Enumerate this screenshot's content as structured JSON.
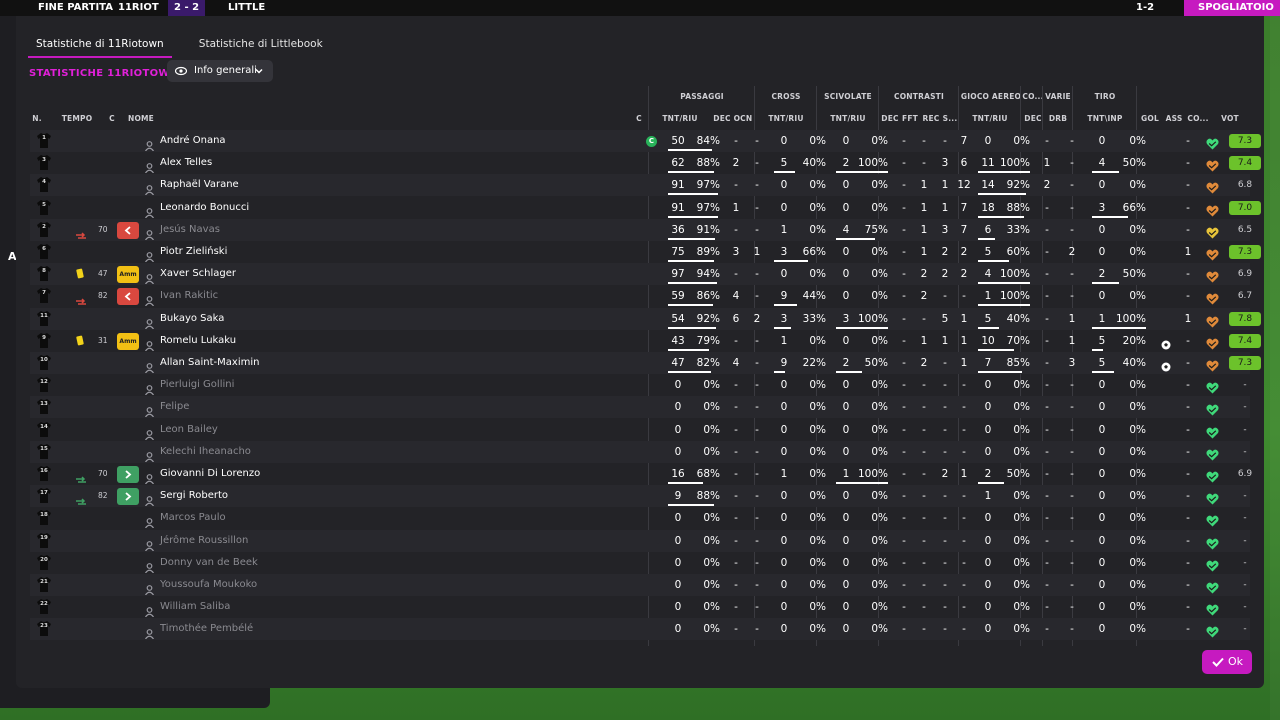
{
  "topbar": {
    "match_label": "FINE PARTITA",
    "home_team": "11RIOT",
    "score": "2 - 2",
    "away_team": "LITTLE",
    "extra": "1-2",
    "exit_label": "SPOGLIATOIO"
  },
  "left_letter": "A",
  "tabs": [
    {
      "label": "Statistiche di 11Riotown",
      "active": true
    },
    {
      "label": "Statistiche di Littlebook",
      "active": false
    }
  ],
  "section_title": "STATISTICHE 11RIOTOWN",
  "view_dropdown": {
    "label": "Info generali",
    "icon": "eye-icon"
  },
  "groups": {
    "passaggi": "PASSAGGI",
    "cross": "CROSS",
    "scivolate": "SCIVOLATE",
    "contrasti": "CONTRASTI",
    "gioco_aereo": "GIOCO AEREO",
    "co": "CO...",
    "varie": "VARIE",
    "tiro": "TIRO"
  },
  "columns": {
    "n": "N.",
    "tempo": "TEMPO",
    "c": "C",
    "nome": "NOME",
    "cap": "C",
    "pass_tnt": "TNT/RIU",
    "pass_dec": "DEC",
    "pass_ocn": "OCN",
    "cross_tnt": "TNT/RIU",
    "sciv_tnt": "TNT/RIU",
    "con_dec": "DEC",
    "con_fft": "FFT",
    "con_rec": "REC",
    "con_s": "S...",
    "aereo_tnt": "TNT/RIU",
    "co_dec": "DEC",
    "drb": "DRB",
    "tiro_tnt": "TNT\\INP",
    "gol": "GOL",
    "ass": "ASS",
    "cond": "CO...",
    "vot": "VOT"
  },
  "colors": {
    "accent": "#c61ac0",
    "vote_green": "#6cc22b",
    "heart_green": "#3fd97a",
    "heart_orange": "#e08a3a",
    "heart_yellow": "#e8c43a",
    "sub_out": "#d9483f",
    "sub_in": "#3fa063",
    "card_yellow": "#f2d21a"
  },
  "players": [
    {
      "num": "1",
      "name": "André Onana",
      "dim": false,
      "captain": "C",
      "tempo": "",
      "event": "",
      "minute": "",
      "pass": [
        "50",
        "84%"
      ],
      "pass_bar": 0.84,
      "pdec": "-",
      "pocn": "-",
      "cross": [
        "0",
        "0%"
      ],
      "cross_bar": 0,
      "sciv": [
        "0",
        "0%"
      ],
      "sciv_bar": 0,
      "cdec": "-",
      "cfft": "-",
      "crec": "-",
      "cs": "7",
      "aereo": [
        "0",
        "0%"
      ],
      "aereo_bar": 0,
      "codec": "-",
      "drb": "-",
      "tiro": [
        "0",
        "0%"
      ],
      "tiro_bar": 0,
      "gol": "",
      "ass": "-",
      "heart": "green",
      "vote": "7.3",
      "vote_green": true
    },
    {
      "num": "3",
      "name": "Alex Telles",
      "dim": false,
      "captain": "",
      "tempo": "",
      "event": "",
      "minute": "",
      "pass": [
        "62",
        "88%"
      ],
      "pass_bar": 0.88,
      "pdec": "2",
      "pocn": "-",
      "cross": [
        "5",
        "40%"
      ],
      "cross_bar": 0.4,
      "sciv": [
        "2",
        "100%"
      ],
      "sciv_bar": 1,
      "cdec": "-",
      "cfft": "-",
      "crec": "3",
      "cs": "6",
      "aereo": [
        "11",
        "100%"
      ],
      "aereo_bar": 1,
      "codec": "1",
      "drb": "-",
      "tiro": [
        "4",
        "50%"
      ],
      "tiro_bar": 0.5,
      "gol": "",
      "ass": "-",
      "heart": "orange",
      "vote": "7.4",
      "vote_green": true
    },
    {
      "num": "4",
      "name": "Raphaël Varane",
      "dim": false,
      "captain": "",
      "tempo": "",
      "event": "",
      "minute": "",
      "pass": [
        "91",
        "97%"
      ],
      "pass_bar": 0.97,
      "pdec": "-",
      "pocn": "-",
      "cross": [
        "0",
        "0%"
      ],
      "cross_bar": 0,
      "sciv": [
        "0",
        "0%"
      ],
      "sciv_bar": 0,
      "cdec": "-",
      "cfft": "1",
      "crec": "1",
      "cs": "12",
      "aereo": [
        "14",
        "92%"
      ],
      "aereo_bar": 0.92,
      "codec": "2",
      "drb": "-",
      "tiro": [
        "0",
        "0%"
      ],
      "tiro_bar": 0,
      "gol": "",
      "ass": "-",
      "heart": "orange",
      "vote": "6.8",
      "vote_green": false
    },
    {
      "num": "5",
      "name": "Leonardo Bonucci",
      "dim": false,
      "captain": "",
      "tempo": "",
      "event": "",
      "minute": "",
      "pass": [
        "91",
        "97%"
      ],
      "pass_bar": 0.97,
      "pdec": "1",
      "pocn": "-",
      "cross": [
        "0",
        "0%"
      ],
      "cross_bar": 0,
      "sciv": [
        "0",
        "0%"
      ],
      "sciv_bar": 0,
      "cdec": "-",
      "cfft": "1",
      "crec": "1",
      "cs": "7",
      "aereo": [
        "18",
        "88%"
      ],
      "aereo_bar": 0.88,
      "codec": "-",
      "drb": "-",
      "tiro": [
        "3",
        "66%"
      ],
      "tiro_bar": 0.66,
      "gol": "",
      "ass": "-",
      "heart": "orange",
      "vote": "7.0",
      "vote_green": true
    },
    {
      "num": "2",
      "name": "Jesús Navas",
      "dim": true,
      "captain": "",
      "tempo": "out",
      "event": "sub-out",
      "minute": "70",
      "pass": [
        "36",
        "91%"
      ],
      "pass_bar": 0.91,
      "pdec": "-",
      "pocn": "-",
      "cross": [
        "1",
        "0%"
      ],
      "cross_bar": 0,
      "sciv": [
        "4",
        "75%"
      ],
      "sciv_bar": 0.75,
      "cdec": "-",
      "cfft": "1",
      "crec": "3",
      "cs": "7",
      "aereo": [
        "6",
        "33%"
      ],
      "aereo_bar": 0.33,
      "codec": "-",
      "drb": "-",
      "tiro": [
        "0",
        "0%"
      ],
      "tiro_bar": 0,
      "gol": "",
      "ass": "-",
      "heart": "yellow",
      "vote": "6.5",
      "vote_green": false
    },
    {
      "num": "6",
      "name": "Piotr Zieliński",
      "dim": false,
      "captain": "",
      "tempo": "",
      "event": "",
      "minute": "",
      "pass": [
        "75",
        "89%"
      ],
      "pass_bar": 0.89,
      "pdec": "3",
      "pocn": "1",
      "cross": [
        "3",
        "66%"
      ],
      "cross_bar": 0.66,
      "sciv": [
        "0",
        "0%"
      ],
      "sciv_bar": 0,
      "cdec": "-",
      "cfft": "1",
      "crec": "2",
      "cs": "2",
      "aereo": [
        "5",
        "60%"
      ],
      "aereo_bar": 0.6,
      "codec": "-",
      "drb": "2",
      "tiro": [
        "0",
        "0%"
      ],
      "tiro_bar": 0,
      "gol": "",
      "ass": "1",
      "heart": "orange",
      "vote": "7.3",
      "vote_green": true
    },
    {
      "num": "8",
      "name": "Xaver Schlager",
      "dim": false,
      "captain": "",
      "tempo": "amm",
      "event": "yellow",
      "minute": "47",
      "pass": [
        "97",
        "94%"
      ],
      "pass_bar": 0.94,
      "pdec": "-",
      "pocn": "-",
      "cross": [
        "0",
        "0%"
      ],
      "cross_bar": 0,
      "sciv": [
        "0",
        "0%"
      ],
      "sciv_bar": 0,
      "cdec": "-",
      "cfft": "2",
      "crec": "2",
      "cs": "2",
      "aereo": [
        "4",
        "100%"
      ],
      "aereo_bar": 1,
      "codec": "-",
      "drb": "-",
      "tiro": [
        "2",
        "50%"
      ],
      "tiro_bar": 0.5,
      "gol": "",
      "ass": "-",
      "heart": "orange",
      "vote": "6.9",
      "vote_green": false
    },
    {
      "num": "7",
      "name": "Ivan Rakitic",
      "dim": true,
      "captain": "",
      "tempo": "out",
      "event": "sub-out",
      "minute": "82",
      "pass": [
        "59",
        "86%"
      ],
      "pass_bar": 0.86,
      "pdec": "4",
      "pocn": "-",
      "cross": [
        "9",
        "44%"
      ],
      "cross_bar": 0.44,
      "sciv": [
        "0",
        "0%"
      ],
      "sciv_bar": 0,
      "cdec": "-",
      "cfft": "2",
      "crec": "-",
      "cs": "-",
      "aereo": [
        "1",
        "100%"
      ],
      "aereo_bar": 1,
      "codec": "-",
      "drb": "-",
      "tiro": [
        "0",
        "0%"
      ],
      "tiro_bar": 0,
      "gol": "",
      "ass": "-",
      "heart": "orange",
      "vote": "6.7",
      "vote_green": false
    },
    {
      "num": "11",
      "name": "Bukayo Saka",
      "dim": false,
      "captain": "",
      "tempo": "",
      "event": "",
      "minute": "",
      "pass": [
        "54",
        "92%"
      ],
      "pass_bar": 0.92,
      "pdec": "6",
      "pocn": "2",
      "cross": [
        "3",
        "33%"
      ],
      "cross_bar": 0.33,
      "sciv": [
        "3",
        "100%"
      ],
      "sciv_bar": 1,
      "cdec": "-",
      "cfft": "-",
      "crec": "5",
      "cs": "1",
      "aereo": [
        "5",
        "40%"
      ],
      "aereo_bar": 0.4,
      "codec": "-",
      "drb": "1",
      "tiro": [
        "1",
        "100%"
      ],
      "tiro_bar": 1,
      "gol": "",
      "ass": "1",
      "heart": "orange",
      "vote": "7.8",
      "vote_green": true
    },
    {
      "num": "9",
      "name": "Romelu Lukaku",
      "dim": false,
      "captain": "",
      "tempo": "amm",
      "event": "yellow",
      "minute": "31",
      "pass": [
        "43",
        "79%"
      ],
      "pass_bar": 0.79,
      "pdec": "-",
      "pocn": "-",
      "cross": [
        "1",
        "0%"
      ],
      "cross_bar": 0,
      "sciv": [
        "0",
        "0%"
      ],
      "sciv_bar": 0,
      "cdec": "-",
      "cfft": "1",
      "crec": "1",
      "cs": "1",
      "aereo": [
        "10",
        "70%"
      ],
      "aereo_bar": 0.7,
      "codec": "-",
      "drb": "1",
      "tiro": [
        "5",
        "20%"
      ],
      "tiro_bar": 0.2,
      "gol": "ball",
      "ass": "-",
      "heart": "orange",
      "vote": "7.4",
      "vote_green": true
    },
    {
      "num": "10",
      "name": "Allan Saint-Maximin",
      "dim": false,
      "captain": "",
      "tempo": "",
      "event": "",
      "minute": "",
      "pass": [
        "47",
        "82%"
      ],
      "pass_bar": 0.82,
      "pdec": "4",
      "pocn": "-",
      "cross": [
        "9",
        "22%"
      ],
      "cross_bar": 0.22,
      "sciv": [
        "2",
        "50%"
      ],
      "sciv_bar": 0.5,
      "cdec": "-",
      "cfft": "2",
      "crec": "-",
      "cs": "1",
      "aereo": [
        "7",
        "85%"
      ],
      "aereo_bar": 0.85,
      "codec": "-",
      "drb": "3",
      "tiro": [
        "5",
        "40%"
      ],
      "tiro_bar": 0.4,
      "gol": "ball",
      "ass": "-",
      "heart": "orange",
      "vote": "7.3",
      "vote_green": true
    },
    {
      "num": "12",
      "name": "Pierluigi Gollini",
      "dim": true,
      "captain": "",
      "tempo": "",
      "event": "",
      "minute": "",
      "pass": [
        "0",
        "0%"
      ],
      "pass_bar": 0,
      "pdec": "-",
      "pocn": "-",
      "cross": [
        "0",
        "0%"
      ],
      "cross_bar": 0,
      "sciv": [
        "0",
        "0%"
      ],
      "sciv_bar": 0,
      "cdec": "-",
      "cfft": "-",
      "crec": "-",
      "cs": "-",
      "aereo": [
        "0",
        "0%"
      ],
      "aereo_bar": 0,
      "codec": "-",
      "drb": "-",
      "tiro": [
        "0",
        "0%"
      ],
      "tiro_bar": 0,
      "gol": "",
      "ass": "-",
      "heart": "green",
      "vote": "-",
      "vote_green": false
    },
    {
      "num": "13",
      "name": "Felipe",
      "dim": true,
      "captain": "",
      "tempo": "",
      "event": "",
      "minute": "",
      "pass": [
        "0",
        "0%"
      ],
      "pass_bar": 0,
      "pdec": "-",
      "pocn": "-",
      "cross": [
        "0",
        "0%"
      ],
      "cross_bar": 0,
      "sciv": [
        "0",
        "0%"
      ],
      "sciv_bar": 0,
      "cdec": "-",
      "cfft": "-",
      "crec": "-",
      "cs": "-",
      "aereo": [
        "0",
        "0%"
      ],
      "aereo_bar": 0,
      "codec": "-",
      "drb": "-",
      "tiro": [
        "0",
        "0%"
      ],
      "tiro_bar": 0,
      "gol": "",
      "ass": "-",
      "heart": "green",
      "vote": "-",
      "vote_green": false
    },
    {
      "num": "14",
      "name": "Leon Bailey",
      "dim": true,
      "captain": "",
      "tempo": "",
      "event": "",
      "minute": "",
      "pass": [
        "0",
        "0%"
      ],
      "pass_bar": 0,
      "pdec": "-",
      "pocn": "-",
      "cross": [
        "0",
        "0%"
      ],
      "cross_bar": 0,
      "sciv": [
        "0",
        "0%"
      ],
      "sciv_bar": 0,
      "cdec": "-",
      "cfft": "-",
      "crec": "-",
      "cs": "-",
      "aereo": [
        "0",
        "0%"
      ],
      "aereo_bar": 0,
      "codec": "-",
      "drb": "-",
      "tiro": [
        "0",
        "0%"
      ],
      "tiro_bar": 0,
      "gol": "",
      "ass": "-",
      "heart": "green",
      "vote": "-",
      "vote_green": false
    },
    {
      "num": "15",
      "name": "Kelechi Iheanacho",
      "dim": true,
      "captain": "",
      "tempo": "",
      "event": "",
      "minute": "",
      "pass": [
        "0",
        "0%"
      ],
      "pass_bar": 0,
      "pdec": "-",
      "pocn": "-",
      "cross": [
        "0",
        "0%"
      ],
      "cross_bar": 0,
      "sciv": [
        "0",
        "0%"
      ],
      "sciv_bar": 0,
      "cdec": "-",
      "cfft": "-",
      "crec": "-",
      "cs": "-",
      "aereo": [
        "0",
        "0%"
      ],
      "aereo_bar": 0,
      "codec": "-",
      "drb": "-",
      "tiro": [
        "0",
        "0%"
      ],
      "tiro_bar": 0,
      "gol": "",
      "ass": "-",
      "heart": "green",
      "vote": "-",
      "vote_green": false
    },
    {
      "num": "16",
      "name": "Giovanni Di Lorenzo",
      "dim": false,
      "captain": "",
      "tempo": "in",
      "event": "sub-in",
      "minute": "70",
      "pass": [
        "16",
        "68%"
      ],
      "pass_bar": 0.68,
      "pdec": "-",
      "pocn": "-",
      "cross": [
        "1",
        "0%"
      ],
      "cross_bar": 0,
      "sciv": [
        "1",
        "100%"
      ],
      "sciv_bar": 1,
      "cdec": "-",
      "cfft": "-",
      "crec": "2",
      "cs": "1",
      "aereo": [
        "2",
        "50%"
      ],
      "aereo_bar": 0.5,
      "codec": "-",
      "drb": "-",
      "tiro": [
        "0",
        "0%"
      ],
      "tiro_bar": 0,
      "gol": "",
      "ass": "-",
      "heart": "green",
      "vote": "6.9",
      "vote_green": false
    },
    {
      "num": "17",
      "name": "Sergi Roberto",
      "dim": false,
      "captain": "",
      "tempo": "in",
      "event": "sub-in",
      "minute": "82",
      "pass": [
        "9",
        "88%"
      ],
      "pass_bar": 0.88,
      "pdec": "-",
      "pocn": "-",
      "cross": [
        "0",
        "0%"
      ],
      "cross_bar": 0,
      "sciv": [
        "0",
        "0%"
      ],
      "sciv_bar": 0,
      "cdec": "-",
      "cfft": "-",
      "crec": "-",
      "cs": "-",
      "aereo": [
        "1",
        "0%"
      ],
      "aereo_bar": 0,
      "codec": "-",
      "drb": "-",
      "tiro": [
        "0",
        "0%"
      ],
      "tiro_bar": 0,
      "gol": "",
      "ass": "-",
      "heart": "green",
      "vote": "-",
      "vote_green": false
    },
    {
      "num": "18",
      "name": "Marcos Paulo",
      "dim": true,
      "captain": "",
      "tempo": "",
      "event": "",
      "minute": "",
      "pass": [
        "0",
        "0%"
      ],
      "pass_bar": 0,
      "pdec": "-",
      "pocn": "-",
      "cross": [
        "0",
        "0%"
      ],
      "cross_bar": 0,
      "sciv": [
        "0",
        "0%"
      ],
      "sciv_bar": 0,
      "cdec": "-",
      "cfft": "-",
      "crec": "-",
      "cs": "-",
      "aereo": [
        "0",
        "0%"
      ],
      "aereo_bar": 0,
      "codec": "-",
      "drb": "-",
      "tiro": [
        "0",
        "0%"
      ],
      "tiro_bar": 0,
      "gol": "",
      "ass": "-",
      "heart": "green",
      "vote": "-",
      "vote_green": false
    },
    {
      "num": "19",
      "name": "Jérôme Roussillon",
      "dim": true,
      "captain": "",
      "tempo": "",
      "event": "",
      "minute": "",
      "pass": [
        "0",
        "0%"
      ],
      "pass_bar": 0,
      "pdec": "-",
      "pocn": "-",
      "cross": [
        "0",
        "0%"
      ],
      "cross_bar": 0,
      "sciv": [
        "0",
        "0%"
      ],
      "sciv_bar": 0,
      "cdec": "-",
      "cfft": "-",
      "crec": "-",
      "cs": "-",
      "aereo": [
        "0",
        "0%"
      ],
      "aereo_bar": 0,
      "codec": "-",
      "drb": "-",
      "tiro": [
        "0",
        "0%"
      ],
      "tiro_bar": 0,
      "gol": "",
      "ass": "-",
      "heart": "green",
      "vote": "-",
      "vote_green": false
    },
    {
      "num": "20",
      "name": "Donny van de Beek",
      "dim": true,
      "captain": "",
      "tempo": "",
      "event": "",
      "minute": "",
      "pass": [
        "0",
        "0%"
      ],
      "pass_bar": 0,
      "pdec": "-",
      "pocn": "-",
      "cross": [
        "0",
        "0%"
      ],
      "cross_bar": 0,
      "sciv": [
        "0",
        "0%"
      ],
      "sciv_bar": 0,
      "cdec": "-",
      "cfft": "-",
      "crec": "-",
      "cs": "-",
      "aereo": [
        "0",
        "0%"
      ],
      "aereo_bar": 0,
      "codec": "-",
      "drb": "-",
      "tiro": [
        "0",
        "0%"
      ],
      "tiro_bar": 0,
      "gol": "",
      "ass": "-",
      "heart": "green",
      "vote": "-",
      "vote_green": false
    },
    {
      "num": "21",
      "name": "Youssoufa Moukoko",
      "dim": true,
      "captain": "",
      "tempo": "",
      "event": "",
      "minute": "",
      "pass": [
        "0",
        "0%"
      ],
      "pass_bar": 0,
      "pdec": "-",
      "pocn": "-",
      "cross": [
        "0",
        "0%"
      ],
      "cross_bar": 0,
      "sciv": [
        "0",
        "0%"
      ],
      "sciv_bar": 0,
      "cdec": "-",
      "cfft": "-",
      "crec": "-",
      "cs": "-",
      "aereo": [
        "0",
        "0%"
      ],
      "aereo_bar": 0,
      "codec": "-",
      "drb": "-",
      "tiro": [
        "0",
        "0%"
      ],
      "tiro_bar": 0,
      "gol": "",
      "ass": "-",
      "heart": "green",
      "vote": "-",
      "vote_green": false
    },
    {
      "num": "22",
      "name": "William Saliba",
      "dim": true,
      "captain": "",
      "tempo": "",
      "event": "",
      "minute": "",
      "pass": [
        "0",
        "0%"
      ],
      "pass_bar": 0,
      "pdec": "-",
      "pocn": "-",
      "cross": [
        "0",
        "0%"
      ],
      "cross_bar": 0,
      "sciv": [
        "0",
        "0%"
      ],
      "sciv_bar": 0,
      "cdec": "-",
      "cfft": "-",
      "crec": "-",
      "cs": "-",
      "aereo": [
        "0",
        "0%"
      ],
      "aereo_bar": 0,
      "codec": "-",
      "drb": "-",
      "tiro": [
        "0",
        "0%"
      ],
      "tiro_bar": 0,
      "gol": "",
      "ass": "-",
      "heart": "green",
      "vote": "-",
      "vote_green": false
    },
    {
      "num": "23",
      "name": "Timothée Pembélé",
      "dim": true,
      "captain": "",
      "tempo": "",
      "event": "",
      "minute": "",
      "pass": [
        "0",
        "0%"
      ],
      "pass_bar": 0,
      "pdec": "-",
      "pocn": "-",
      "cross": [
        "0",
        "0%"
      ],
      "cross_bar": 0,
      "sciv": [
        "0",
        "0%"
      ],
      "sciv_bar": 0,
      "cdec": "-",
      "cfft": "-",
      "crec": "-",
      "cs": "-",
      "aereo": [
        "0",
        "0%"
      ],
      "aereo_bar": 0,
      "codec": "-",
      "drb": "-",
      "tiro": [
        "0",
        "0%"
      ],
      "tiro_bar": 0,
      "gol": "",
      "ass": "-",
      "heart": "green",
      "vote": "-",
      "vote_green": false
    }
  ],
  "ok_button": {
    "label": "Ok"
  }
}
